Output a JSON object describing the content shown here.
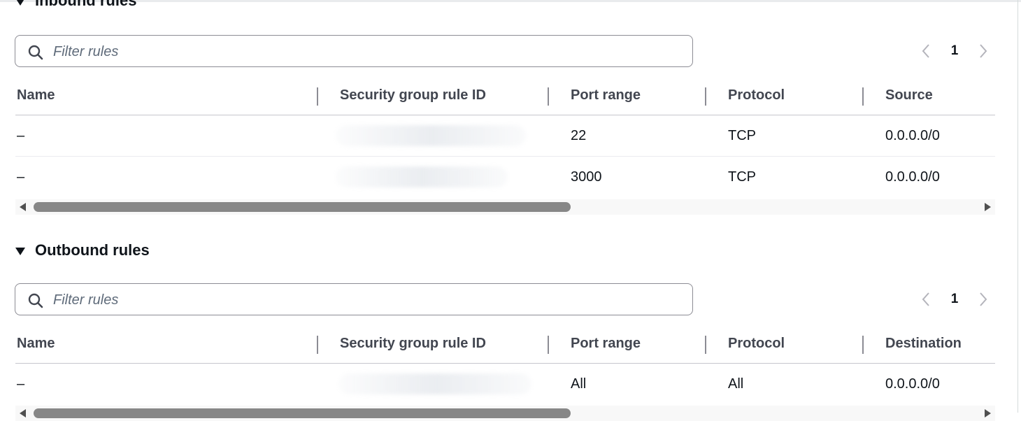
{
  "inbound": {
    "title": "Inbound rules",
    "filter_placeholder": "Filter rules",
    "page": "1",
    "columns": [
      "Name",
      "Security group rule ID",
      "Port range",
      "Protocol",
      "Source"
    ],
    "rows": [
      {
        "name": "–",
        "port_range": "22",
        "protocol": "TCP",
        "source": "0.0.0.0/0"
      },
      {
        "name": "–",
        "port_range": "3000",
        "protocol": "TCP",
        "source": "0.0.0.0/0"
      }
    ]
  },
  "outbound": {
    "title": "Outbound rules",
    "filter_placeholder": "Filter rules",
    "page": "1",
    "columns": [
      "Name",
      "Security group rule ID",
      "Port range",
      "Protocol",
      "Destination"
    ],
    "rows": [
      {
        "name": "–",
        "port_range": "All",
        "protocol": "All",
        "destination": "0.0.0.0/0"
      }
    ]
  },
  "icons": {
    "collapse": "caret-down-icon",
    "search": "search-icon",
    "prev": "chevron-left-icon",
    "next": "chevron-right-icon"
  },
  "colors": {
    "text": "#0f141a",
    "header_text": "#424650",
    "placeholder": "#5f6b7a",
    "border": "#8c8c94",
    "scroll_thumb": "#878787"
  }
}
